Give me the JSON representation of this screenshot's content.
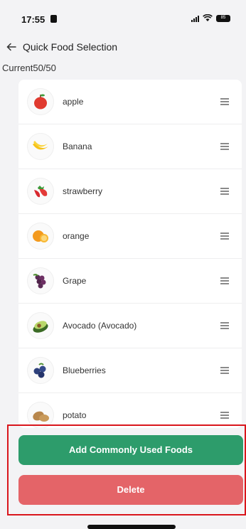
{
  "status_bar": {
    "time": "17:55",
    "battery": "85"
  },
  "header": {
    "back_icon": "back-arrow-icon",
    "title": "Quick Food Selection"
  },
  "counter": "Current50/50",
  "foods": [
    {
      "name": "apple",
      "icon": "apple-icon"
    },
    {
      "name": "Banana",
      "icon": "banana-icon"
    },
    {
      "name": "strawberry",
      "icon": "strawberry-icon"
    },
    {
      "name": "orange",
      "icon": "orange-icon"
    },
    {
      "name": "Grape",
      "icon": "grape-icon"
    },
    {
      "name": "Avocado (Avocado)",
      "icon": "avocado-icon"
    },
    {
      "name": "Blueberries",
      "icon": "blueberries-icon"
    },
    {
      "name": "potato",
      "icon": "potato-icon"
    }
  ],
  "actions": {
    "add_label": "Add Commonly Used Foods",
    "delete_label": "Delete"
  },
  "colors": {
    "add_button": "#2d9c6b",
    "delete_button": "#e46468",
    "highlight_border": "#d9161c"
  }
}
